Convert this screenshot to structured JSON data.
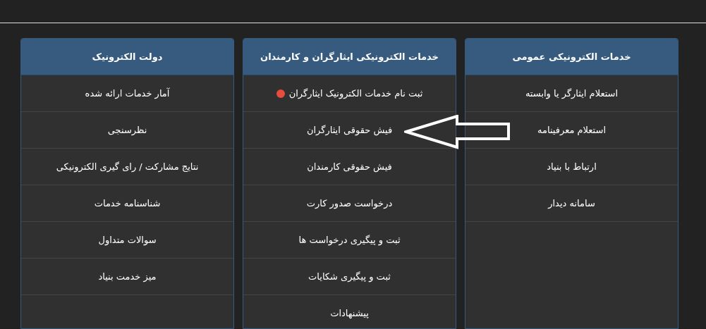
{
  "columns": [
    {
      "title": "خدمات الکترونیکی عمومی",
      "items": [
        {
          "label": "استعلام ایثارگر یا وابسته",
          "new": false
        },
        {
          "label": "استعلام معرفینامه",
          "new": false
        },
        {
          "label": "ارتباط با بنیاد",
          "new": false
        },
        {
          "label": "سامانه دیدار",
          "new": false
        }
      ]
    },
    {
      "title": "خدمات الکترونیکی ایثارگران و کارمندان",
      "items": [
        {
          "label": "ثبت نام خدمات الکترونیک ایثارگران",
          "new": true
        },
        {
          "label": "فیش حقوقی ایثارگران",
          "new": false
        },
        {
          "label": "فیش حقوقی کارمندان",
          "new": false
        },
        {
          "label": "درخواست صدور کارت",
          "new": false
        },
        {
          "label": "ثبت و پیگیری درخواست ها",
          "new": false
        },
        {
          "label": "ثبت و پیگیری شکایات",
          "new": false
        },
        {
          "label": "پیشنهادات",
          "new": false
        }
      ]
    },
    {
      "title": "دولت الکترونیک",
      "items": [
        {
          "label": "آمار خدمات ارائه شده",
          "new": false
        },
        {
          "label": "نظرسنجی",
          "new": false
        },
        {
          "label": "نتایج مشارکت / رای گیری الکترونیکی",
          "new": false
        },
        {
          "label": "شناسنامه خدمات",
          "new": false
        },
        {
          "label": "سوالات متداول",
          "new": false
        },
        {
          "label": "میز خدمت بنیاد",
          "new": false
        }
      ]
    }
  ]
}
